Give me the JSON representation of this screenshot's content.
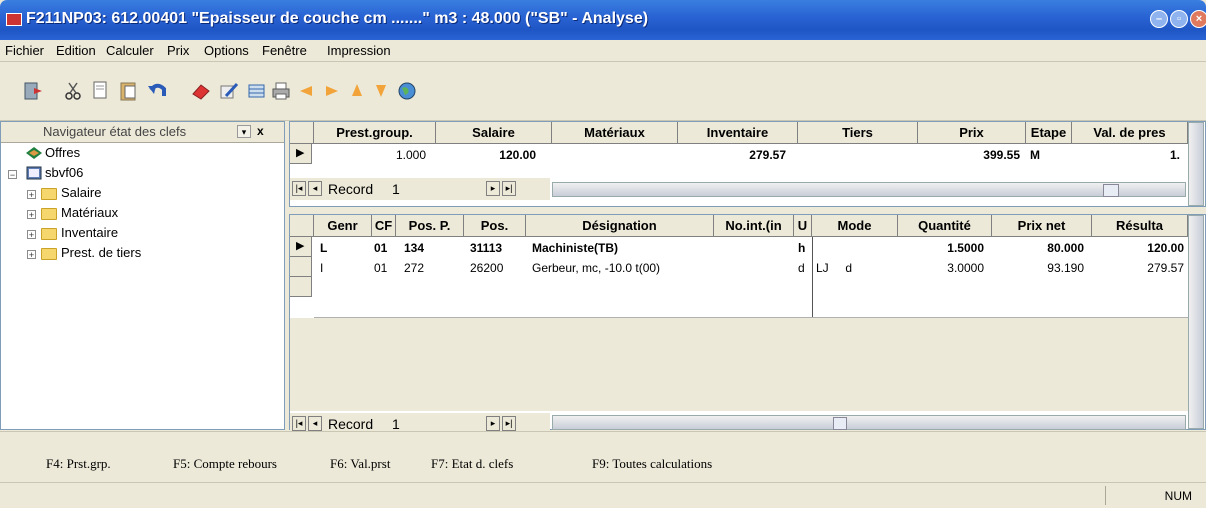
{
  "window": {
    "title": "F211NP03: 612.00401  \"Epaisseur de couche cm .......\" m3 :      48.000 (\"SB\" - Analyse)",
    "buttons": [
      "minimize",
      "maximize",
      "close"
    ]
  },
  "menu": [
    "Fichier",
    "Edition",
    "Calculer",
    "Prix",
    "Options",
    "Fenêtre",
    "Impression"
  ],
  "toolbar": {
    "icons": [
      "exit-icon",
      "cut-icon",
      "copy-icon",
      "paste-icon",
      "undo-icon",
      "eraser-icon",
      "edit-icon",
      "table-icon",
      "print-icon",
      "arrow-left-icon",
      "arrow-right-icon",
      "arrow-up-icon",
      "arrow-down-icon",
      "globe-icon"
    ]
  },
  "navigator": {
    "title": "Navigateur état des clefs",
    "close": "x",
    "items": [
      {
        "label": "Offres",
        "level": 0
      },
      {
        "label": "sbvf06",
        "level": 0
      },
      {
        "label": "Salaire",
        "level": 1
      },
      {
        "label": "Matériaux",
        "level": 1
      },
      {
        "label": "Inventaire",
        "level": 1
      },
      {
        "label": "Prest. de tiers",
        "level": 1
      }
    ]
  },
  "top_grid": {
    "columns": [
      "Prest.group.",
      "Salaire",
      "Matériaux",
      "Inventaire",
      "Tiers",
      "Prix",
      "Etape",
      "Val. de pres"
    ],
    "row": {
      "prest_group": "1.000",
      "salaire": "120.00",
      "materiaux": "",
      "inventaire": "279.57",
      "tiers": "",
      "prix": "399.55",
      "etape": "M",
      "val_pres": "1."
    },
    "record_label": "Record",
    "record_num": "1"
  },
  "bottom_grid": {
    "columns": [
      "Genr",
      "CF",
      "Pos. P.",
      "Pos.",
      "Désignation",
      "No.int.(in",
      "U",
      "Mode",
      "Quantité",
      "Prix net",
      "Résulta"
    ],
    "rows": [
      {
        "genr": "L",
        "cf": "01",
        "posp": "134",
        "pos": "31113",
        "designation": "Machiniste(TB)",
        "noint": "",
        "u": "h",
        "mode": "",
        "quantite": "1.5000",
        "prixnet": "80.000",
        "resultat": "120.00",
        "bold": true
      },
      {
        "genr": "I",
        "cf": "01",
        "posp": "272",
        "pos": "26200",
        "designation": "Gerbeur, mc, -10.0 t(00)",
        "noint": "",
        "u": "d",
        "mode": "LJ     d",
        "quantite": "3.0000",
        "prixnet": "93.190",
        "resultat": "279.57",
        "bold": false
      }
    ],
    "record_label": "Record",
    "record_num": "1"
  },
  "function_keys": [
    "F4: Prst.grp.",
    "F5: Compte rebours",
    "F6: Val.prst",
    "F7: Etat d. clefs",
    "F9: Toutes calculations"
  ],
  "status": {
    "num": "NUM"
  }
}
